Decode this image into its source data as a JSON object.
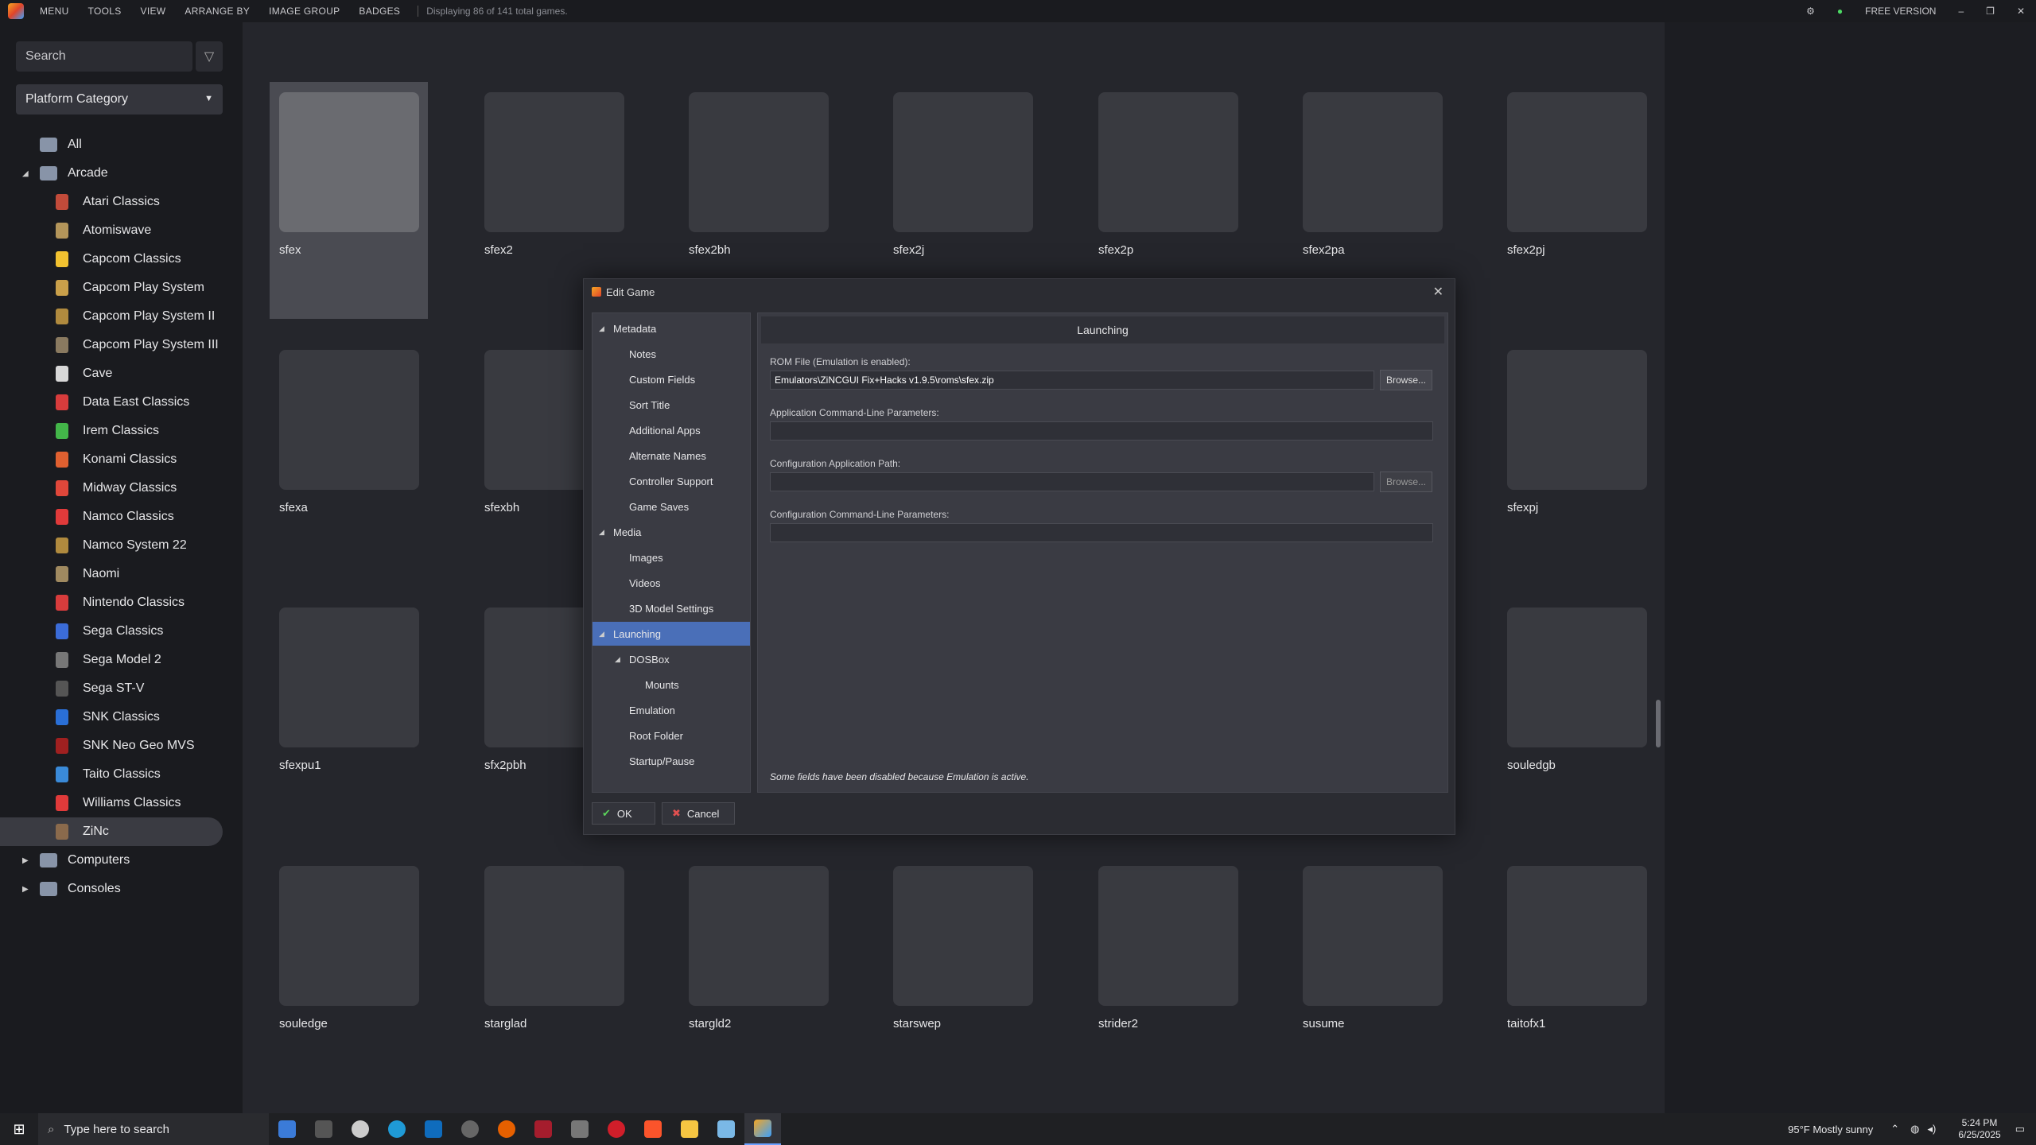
{
  "topbar": {
    "menus": [
      "MENU",
      "TOOLS",
      "VIEW",
      "ARRANGE BY",
      "IMAGE GROUP",
      "BADGES"
    ],
    "status": "Displaying 86 of 141 total games.",
    "version": "FREE VERSION",
    "min_glyph": "–",
    "max_glyph": "❐",
    "close_glyph": "✕"
  },
  "sidebar": {
    "search_placeholder": "Search",
    "platform_select": "Platform Category",
    "items": [
      {
        "label": "All",
        "level": 0,
        "icon": "all-platforms-icon"
      },
      {
        "label": "Arcade",
        "level": 0,
        "expanded": true,
        "icon": "arcade-cabinet-icon"
      },
      {
        "label": "Atari Classics",
        "level": 1
      },
      {
        "label": "Atomiswave",
        "level": 1
      },
      {
        "label": "Capcom Classics",
        "level": 1
      },
      {
        "label": "Capcom Play System",
        "level": 1
      },
      {
        "label": "Capcom Play System II",
        "level": 1
      },
      {
        "label": "Capcom Play System III",
        "level": 1
      },
      {
        "label": "Cave",
        "level": 1
      },
      {
        "label": "Data East Classics",
        "level": 1
      },
      {
        "label": "Irem Classics",
        "level": 1
      },
      {
        "label": "Konami Classics",
        "level": 1
      },
      {
        "label": "Midway Classics",
        "level": 1
      },
      {
        "label": "Namco Classics",
        "level": 1
      },
      {
        "label": "Namco System 22",
        "level": 1
      },
      {
        "label": "Naomi",
        "level": 1
      },
      {
        "label": "Nintendo Classics",
        "level": 1
      },
      {
        "label": "Sega Classics",
        "level": 1
      },
      {
        "label": "Sega Model 2",
        "level": 1
      },
      {
        "label": "Sega ST-V",
        "level": 1
      },
      {
        "label": "SNK Classics",
        "level": 1
      },
      {
        "label": "SNK Neo Geo MVS",
        "level": 1
      },
      {
        "label": "Taito Classics",
        "level": 1
      },
      {
        "label": "Williams Classics",
        "level": 1
      },
      {
        "label": "ZiNc",
        "level": 1,
        "selected": true
      },
      {
        "label": "Computers",
        "level": 0,
        "expanded": false
      },
      {
        "label": "Consoles",
        "level": 0,
        "expanded": false
      }
    ]
  },
  "games": [
    "sfex",
    "sfex2",
    "sfex2bh",
    "sfex2j",
    "sfex2p",
    "sfex2pa",
    "sfex2pj",
    "sfexa",
    "sfexbh",
    "sfexpj",
    "sfexpu1",
    "sfx2pbh",
    "souledgb",
    "souledge",
    "starglad",
    "stargld2",
    "starswep",
    "strider2",
    "susume",
    "taitofx1"
  ],
  "dialog": {
    "title": "Edit Game",
    "tree": [
      {
        "label": "Metadata",
        "level": 0,
        "arrow": "◢"
      },
      {
        "label": "Notes",
        "level": 1
      },
      {
        "label": "Custom Fields",
        "level": 1
      },
      {
        "label": "Sort Title",
        "level": 1
      },
      {
        "label": "Additional Apps",
        "level": 1
      },
      {
        "label": "Alternate Names",
        "level": 1
      },
      {
        "label": "Controller Support",
        "level": 1
      },
      {
        "label": "Game Saves",
        "level": 1
      },
      {
        "label": "Media",
        "level": 0,
        "arrow": "◢"
      },
      {
        "label": "Images",
        "level": 1
      },
      {
        "label": "Videos",
        "level": 1
      },
      {
        "label": "3D Model Settings",
        "level": 1
      },
      {
        "label": "Launching",
        "level": 0,
        "arrow": "◢",
        "selected": true
      },
      {
        "label": "DOSBox",
        "level": 1,
        "arrow": "◢"
      },
      {
        "label": "Mounts",
        "level": 2
      },
      {
        "label": "Emulation",
        "level": 1
      },
      {
        "label": "Root Folder",
        "level": 1
      },
      {
        "label": "Startup/Pause",
        "level": 1
      }
    ],
    "section_title": "Launching",
    "rom_label": "ROM File (Emulation is enabled):",
    "rom_value": "Emulators\\ZiNCGUI Fix+Hacks v1.9.5\\roms\\sfex.zip",
    "browse": "Browse...",
    "app_params_label": "Application Command-Line Parameters:",
    "app_params_value": "",
    "config_path_label": "Configuration Application Path:",
    "config_path_value": "",
    "config_params_label": "Configuration Command-Line Parameters:",
    "config_params_value": "",
    "note": "Some fields have been disabled because Emulation is active.",
    "ok": "OK",
    "cancel": "Cancel"
  },
  "taskbar": {
    "search_placeholder": "Type here to search",
    "weather": "95°F  Mostly sunny",
    "time": "5:24 PM",
    "date": "6/25/2025"
  }
}
